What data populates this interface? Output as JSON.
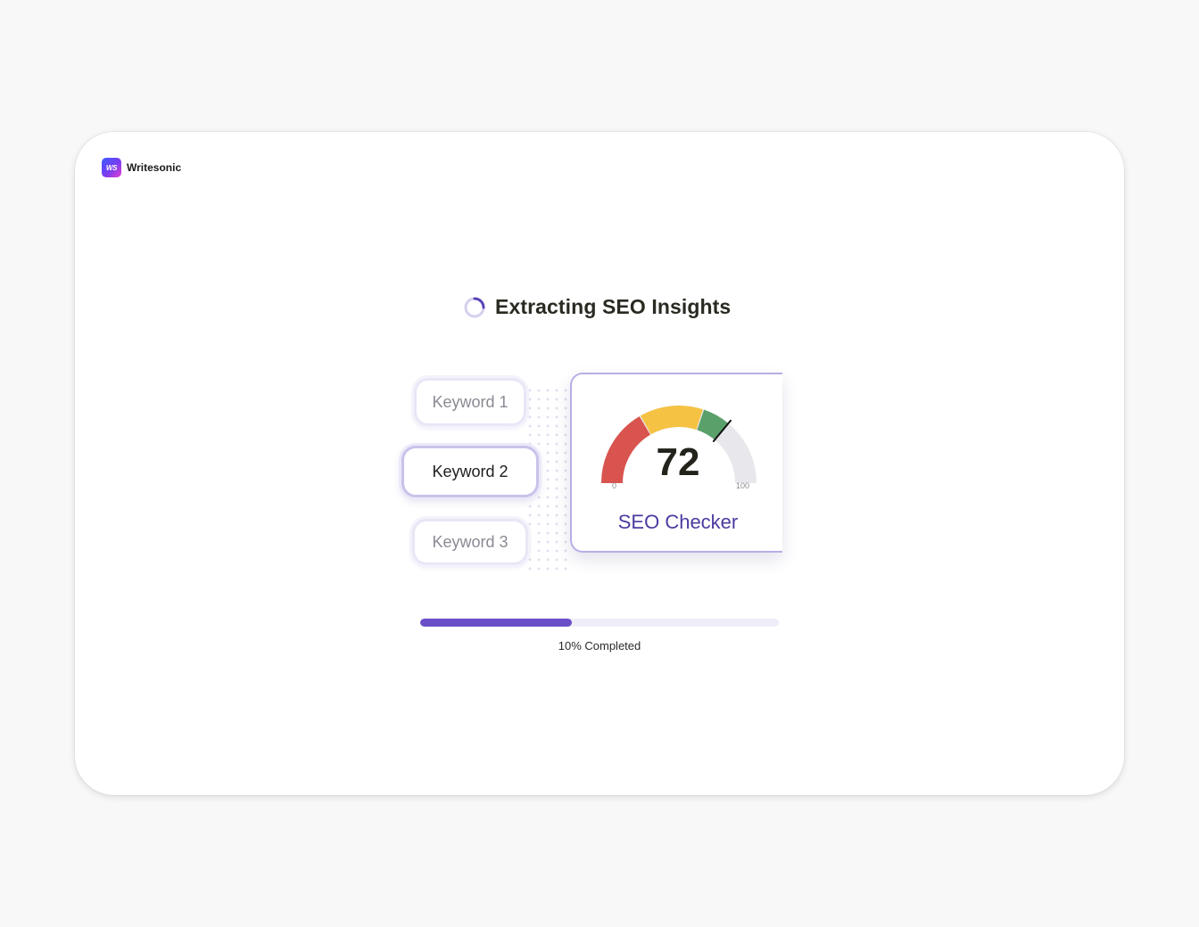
{
  "brand": {
    "logo_text": "WS",
    "name": "Writesonic"
  },
  "status": {
    "title": "Extracting SEO Insights"
  },
  "keywords": [
    {
      "label": "Keyword 1",
      "active": false
    },
    {
      "label": "Keyword 2",
      "active": true
    },
    {
      "label": "Keyword 3",
      "active": false
    }
  ],
  "seo_checker": {
    "label": "SEO Checker",
    "score": "72",
    "min_label": "0",
    "max_label": "100",
    "score_value": 72,
    "colors": {
      "low": "#d9534f",
      "mid": "#f5c244",
      "high": "#5aa06a",
      "empty": "#e8e8ec"
    }
  },
  "progress": {
    "label": "10% Completed",
    "fill_fraction": 0.423,
    "color": "#6a4fc8"
  }
}
